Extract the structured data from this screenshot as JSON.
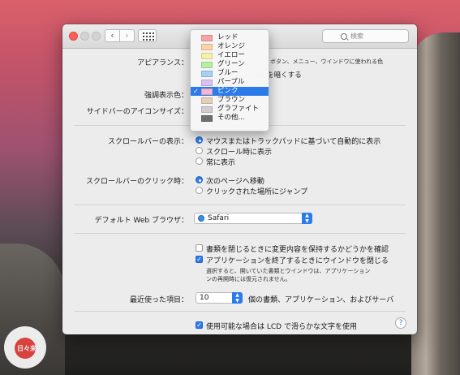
{
  "window": {
    "search_placeholder": "検索"
  },
  "appearance": {
    "label": "アピアランス：",
    "desc": "ボタン、メニュー、ウインドウに使われる色",
    "dark_text": "ck を暗くする"
  },
  "highlight": {
    "label": "強調表示色："
  },
  "sidebar_icon": {
    "label": "サイドバーのアイコンサイズ："
  },
  "color_menu": {
    "items": [
      {
        "label": "レッド",
        "color": "#f5a5a5"
      },
      {
        "label": "オレンジ",
        "color": "#f9d3a4"
      },
      {
        "label": "イエロー",
        "color": "#f6f1a6"
      },
      {
        "label": "グリーン",
        "color": "#b7eea6"
      },
      {
        "label": "ブルー",
        "color": "#a8cff6"
      },
      {
        "label": "パープル",
        "color": "#dcc2f1"
      },
      {
        "label": "ピンク",
        "color": "#f7b7d2"
      },
      {
        "label": "ブラウン",
        "color": "#e3d0b8"
      },
      {
        "label": "グラファイト",
        "color": "#cfcfcf"
      },
      {
        "label": "その他...",
        "color": "#6e6e6e"
      }
    ],
    "selected": "ピンク"
  },
  "scrollbar_show": {
    "label": "スクロールバーの表示：",
    "options": [
      "マウスまたはトラックパッドに基づいて自動的に表示",
      "スクロール時に表示",
      "常に表示"
    ]
  },
  "scrollbar_click": {
    "label": "スクロールバーのクリック時：",
    "options": [
      "次のページへ移動",
      "クリックされた場所にジャンプ"
    ]
  },
  "browser": {
    "label": "デフォルト Web ブラウザ：",
    "value": "Safari"
  },
  "documents": {
    "ask_keep": "書類を閉じるときに変更内容を保持するかどうかを確認",
    "close_windows": "アプリケーションを終了するときにウインドウを閉じる",
    "note_line1": "選択すると、開いていた書類とウインドウは、アプリケーション",
    "note_line2": "ンの再開時には復元されません。"
  },
  "recent": {
    "label": "最近使った項目：",
    "value": "10",
    "desc": "個の書類、アプリケーション、およびサーバ"
  },
  "lcd": {
    "label": "使用可能な場合は LCD で滑らかな文字を使用"
  },
  "help": "?",
  "watermark": "日々来"
}
